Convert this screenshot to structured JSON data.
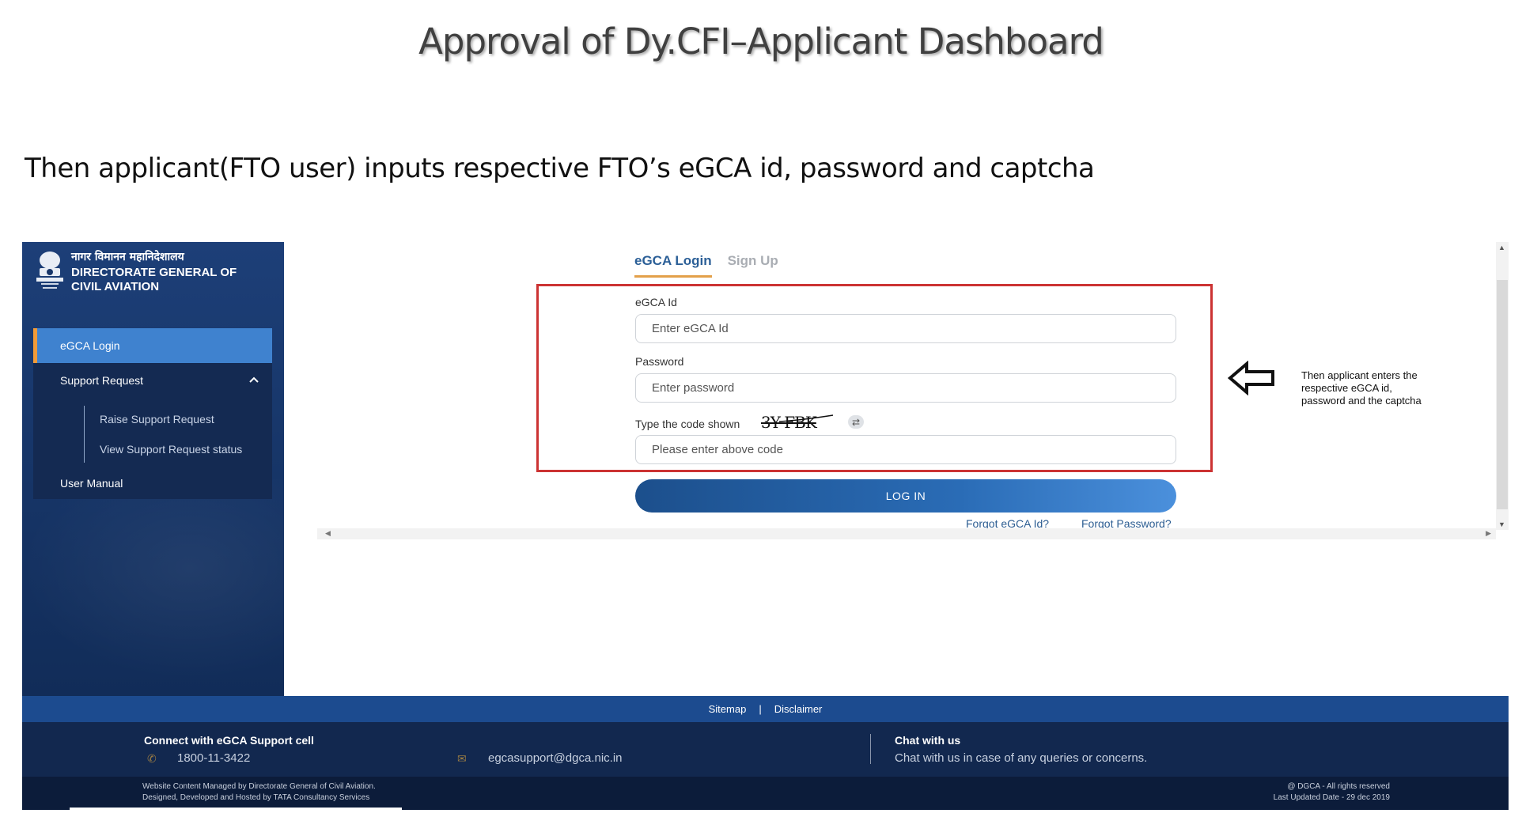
{
  "slide": {
    "title": "Approval of Dy.CFI–Applicant Dashboard",
    "subtitle": "Then applicant(FTO user) inputs respective FTO’s eGCA id, password and captcha"
  },
  "header": {
    "org_hindi": "नागर विमानन महानिदेशालय",
    "org_line1": "DIRECTORATE GENERAL OF",
    "org_line2": "CIVIL AVIATION"
  },
  "sidebar": {
    "items": [
      {
        "label": "eGCA Login",
        "active": true
      },
      {
        "label": "Support Request",
        "expanded": true,
        "icon": "chevron-up-icon"
      },
      {
        "label": "User Manual"
      }
    ],
    "sub_items": [
      "Raise Support Request",
      "View Support Request status"
    ]
  },
  "tabs": [
    {
      "label": "eGCA Login",
      "active": true
    },
    {
      "label": "Sign Up",
      "active": false
    }
  ],
  "form": {
    "egca_label": "eGCA Id",
    "egca_placeholder": "Enter eGCA Id",
    "password_label": "Password",
    "password_placeholder": "Enter password",
    "captcha_label": "Type the code shown",
    "captcha_code": "3Y FBK",
    "captcha_placeholder": "Please enter above code",
    "login_button": "LOG IN",
    "forgot_id": "Forgot eGCA Id?",
    "forgot_password": "Forgot Password?"
  },
  "callout": {
    "text": "Then applicant enters the respective eGCA id, password and the captcha"
  },
  "footer": {
    "sitemap": "Sitemap",
    "divider": "|",
    "disclaimer": "Disclaimer",
    "support_heading": "Connect with eGCA Support cell",
    "phone": "1800-11-3422",
    "email": "egcasupport@dgca.nic.in",
    "chat_heading": "Chat with us",
    "chat_text": "Chat with us in case of any queries or concerns.",
    "managed_by": "Website Content Managed by Directorate General of Civil Aviation.",
    "designed_by": "Designed, Developed and Hosted by TATA Consultancy Services",
    "rights": "@ DGCA - All rights reserved",
    "updated": "Last Updated Date - 29 dec 2019"
  },
  "colors": {
    "highlight_box": "#cc3333",
    "tab_accent": "#e3a04a",
    "primary_blue": "#2b5f97",
    "sidebar_bg": "#173669"
  }
}
